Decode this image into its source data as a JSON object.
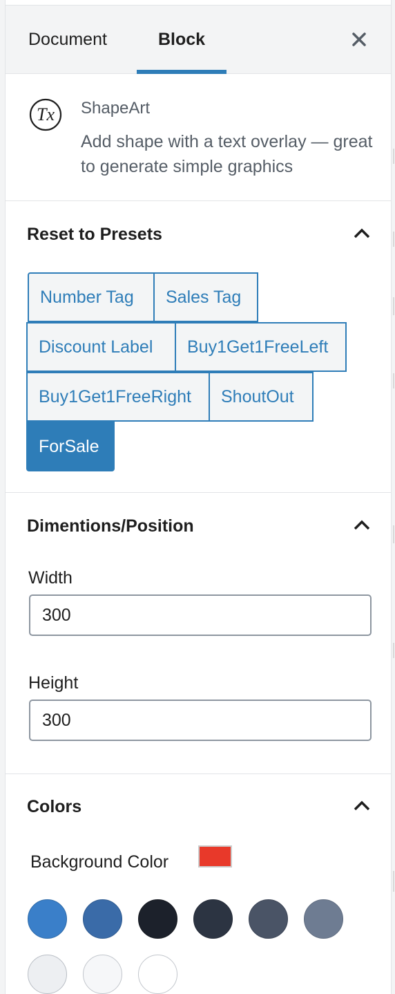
{
  "tabs": {
    "document_label": "Document",
    "block_label": "Block",
    "active": "Block",
    "close_symbol": "×"
  },
  "block": {
    "icon": "tx-icon",
    "icon_text": "Tx",
    "title": "ShapeArt",
    "description": "Add shape with a text overlay — great to generate simple graphics"
  },
  "presets_section": {
    "title": "Reset to Presets",
    "items": [
      {
        "label": "Number Tag",
        "active": false
      },
      {
        "label": "Sales Tag",
        "active": false
      },
      {
        "label": "Discount Label",
        "active": false
      },
      {
        "label": "Buy1Get1FreeLeft",
        "active": false
      },
      {
        "label": "Buy1Get1FreeRight",
        "active": false
      },
      {
        "label": "ShoutOut",
        "active": false
      },
      {
        "label": "ForSale",
        "active": true
      }
    ]
  },
  "dimensions_section": {
    "title": "Dimentions/Position",
    "width_label": "Width",
    "width_value": "300",
    "height_label": "Height",
    "height_value": "300"
  },
  "colors_section": {
    "title": "Colors",
    "background_label": "Background Color",
    "background_value": "#e8392a",
    "palette": [
      {
        "color": "#3a7fc9",
        "border": "#2e6aa8"
      },
      {
        "color": "#3a6ba8",
        "border": "#2d5a90"
      },
      {
        "color": "#1c212b",
        "border": "#14181f"
      },
      {
        "color": "#2c3442",
        "border": "#222936"
      },
      {
        "color": "#4a5466",
        "border": "#3c4556"
      },
      {
        "color": "#6e7c92",
        "border": "#5f6c80"
      },
      {
        "color": "#edeff2",
        "border": "#b9bec5"
      },
      {
        "color": "#f6f7f9",
        "border": "#c2c6cc"
      },
      {
        "color": "#ffffff",
        "border": "#c2c6cc"
      }
    ]
  },
  "theme": {
    "accent": "#2e7db8",
    "panel_bg": "#ffffff",
    "header_bg": "#f3f4f5",
    "border": "#e2e4e7"
  }
}
